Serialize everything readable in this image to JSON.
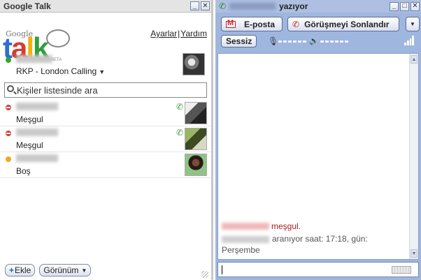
{
  "left": {
    "title": "Google Talk",
    "logo": {
      "small": "Google",
      "big": [
        "t",
        "a",
        "l",
        "k"
      ],
      "badge": "BETA"
    },
    "links": {
      "settings": "Ayarlar",
      "separator": "|",
      "help": "Yardım"
    },
    "me": {
      "status_message": "RKP - London Calling",
      "status_arrow": "▼"
    },
    "search": {
      "placeholder": "Kişiler listesinde ara"
    },
    "contacts": [
      {
        "status": "busy",
        "status_text": "Meşgul",
        "phone": true
      },
      {
        "status": "busy",
        "status_text": "Meşgul",
        "phone": true
      },
      {
        "status": "idle",
        "status_text": "Boş",
        "phone": false
      }
    ],
    "buttons": {
      "add": "Ekle",
      "add_plus": "+",
      "view": "Görünüm",
      "view_arrow": "▼"
    }
  },
  "right": {
    "title_suffix": "yazıyor",
    "buttons": {
      "email": "E-posta",
      "end_call": "Görüşmeyi Sonlandır",
      "more": "▼",
      "mute": "Sessiz"
    },
    "messages": {
      "busy": "meşgul.",
      "calling": "aranıyor saat: 17:18, gün: Perşembe"
    }
  },
  "colors": {
    "chat_frame": "#9fb6de",
    "busy": "#d63b3b",
    "online": "#2ea82e",
    "idle": "#f0a826"
  }
}
